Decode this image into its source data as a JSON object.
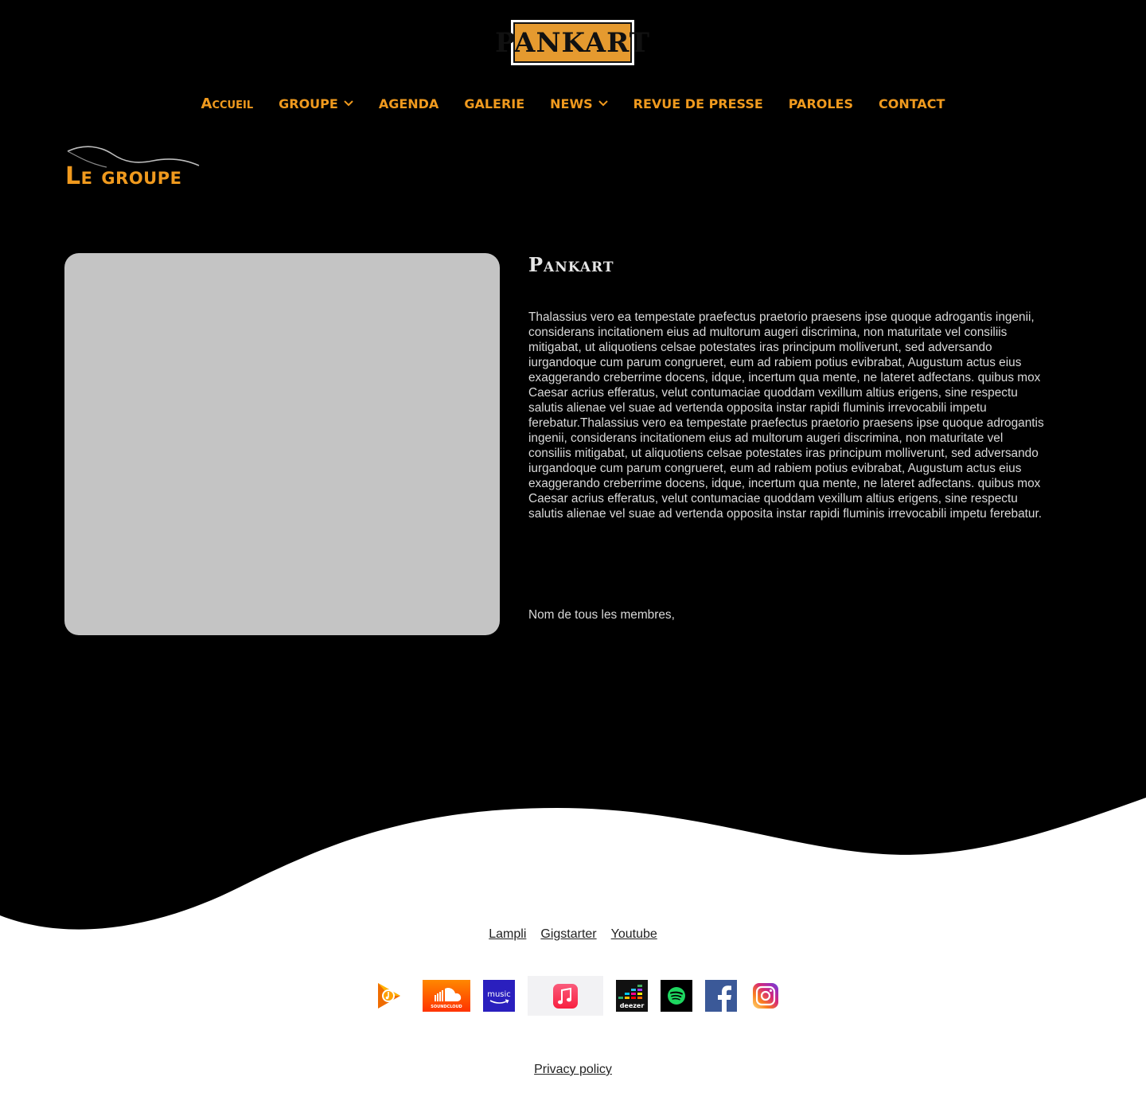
{
  "logo": {
    "text": "PANKART"
  },
  "nav": {
    "items": [
      {
        "label": "Accueil",
        "has_dropdown": false
      },
      {
        "label": "Groupe",
        "has_dropdown": true
      },
      {
        "label": "Agenda",
        "has_dropdown": false
      },
      {
        "label": "Galerie",
        "has_dropdown": false
      },
      {
        "label": "News",
        "has_dropdown": true
      },
      {
        "label": "Revue de presse",
        "has_dropdown": false
      },
      {
        "label": "Paroles",
        "has_dropdown": false
      },
      {
        "label": "Contact",
        "has_dropdown": false
      }
    ]
  },
  "section": {
    "title": "Le groupe"
  },
  "band": {
    "name": "Pankart",
    "bio": "Thalassius vero ea tempestate praefectus praetorio praesens ipse quoque adrogantis ingenii, considerans incitationem eius ad multorum augeri discrimina, non maturitate vel consiliis mitigabat, ut aliquotiens celsae potestates iras principum molliverunt, sed adversando iurgandoque cum parum congrueret, eum ad rabiem potius evibrabat, Augustum actus eius exaggerando creberrime docens, idque, incertum qua mente, ne lateret adfectans. quibus mox Caesar acrius efferatus, velut contumaciae quoddam vexillum altius erigens, sine respectu salutis alienae vel suae ad vertenda opposita instar rapidi fluminis irrevocabili impetu ferebatur.Thalassius vero ea tempestate praefectus praetorio praesens ipse quoque adrogantis ingenii, considerans incitationem eius ad multorum augeri discrimina, non maturitate vel consiliis mitigabat, ut aliquotiens celsae potestates iras principum molliverunt, sed adversando iurgandoque cum parum congrueret, eum ad rabiem potius evibrabat, Augustum actus eius exaggerando creberrime docens, idque, incertum qua mente, ne lateret adfectans. quibus mox Caesar acrius efferatus, velut contumaciae quoddam vexillum altius erigens, sine respectu salutis alienae vel suae ad vertenda opposita instar rapidi fluminis irrevocabili impetu ferebatur.",
    "members": "Nom de tous les membres,"
  },
  "footer": {
    "links": [
      "Lampli",
      "Gigstarter",
      "Youtube"
    ],
    "streaming_icons": [
      "google-play-music-icon",
      "soundcloud-icon",
      "amazon-music-icon",
      "apple-music-icon",
      "deezer-icon",
      "spotify-icon",
      "facebook-icon",
      "instagram-icon"
    ],
    "soundcloud_label": "SOUNDCLOUD",
    "amazon_label": "music",
    "deezer_label": "deezer",
    "privacy": "Privacy policy"
  },
  "colors": {
    "background_dark": "#000000",
    "accent_orange": "#f09a1e",
    "photo_placeholder": "#c4c4c4",
    "text_light": "#d9d9d9"
  }
}
